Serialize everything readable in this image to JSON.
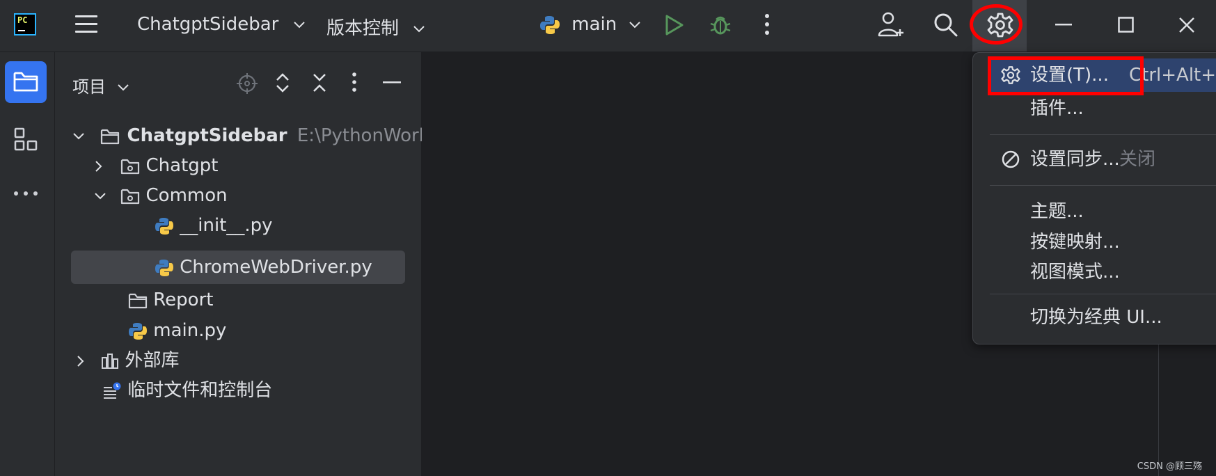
{
  "titlebar": {
    "logo_text": "PC",
    "project_name": "ChatgptSidebar",
    "vcs_label": "版本控制",
    "run_config": "main"
  },
  "project_panel": {
    "title": "项目",
    "tree": [
      {
        "label": "ChatgptSidebar",
        "hint": "E:\\PythonWorkS",
        "kind": "root-folder",
        "expanded": true
      },
      {
        "label": "Chatgpt",
        "kind": "package-folder",
        "expanded": false
      },
      {
        "label": "Common",
        "kind": "package-folder",
        "expanded": true
      },
      {
        "label": "__init__.py",
        "kind": "python-file"
      },
      {
        "label": "ChromeWebDriver.py",
        "kind": "python-file",
        "selected": true
      },
      {
        "label": "Report",
        "kind": "folder"
      },
      {
        "label": "main.py",
        "kind": "python-file"
      },
      {
        "label": "外部库",
        "kind": "libraries",
        "expanded": false
      },
      {
        "label": "临时文件和控制台",
        "kind": "scratches"
      }
    ]
  },
  "menu": {
    "items": [
      {
        "label": "设置(T)...",
        "shortcut": "Ctrl+Alt+S",
        "icon": "gear-icon",
        "active": true
      },
      {
        "label": "插件..."
      },
      {
        "label": "设置同步...",
        "suffix": "关闭",
        "icon": "no-sync-icon"
      },
      {
        "label": "主题..."
      },
      {
        "label": "按键映射..."
      },
      {
        "label": "视图模式..."
      },
      {
        "label": "切换为经典 UI..."
      }
    ]
  },
  "watermark": "CSDN @顾三殇",
  "colors": {
    "background": "#2b2d30",
    "editor": "#1e1f22",
    "accent": "#3574f0",
    "annotation": "#ff0000",
    "run_green": "#57965c"
  }
}
